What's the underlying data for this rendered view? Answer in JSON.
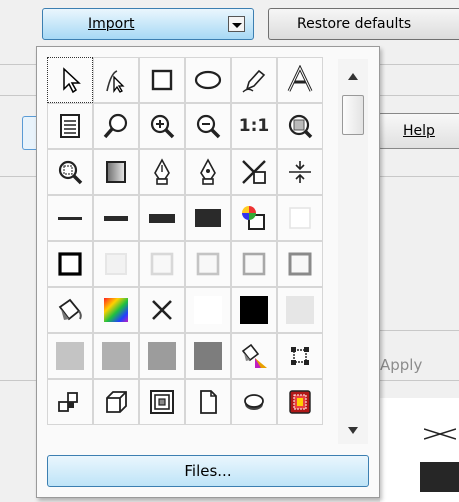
{
  "toolbar": {
    "import_label": "Import",
    "restore_label": "Restore defaults"
  },
  "background": {
    "help_label": "Help",
    "apply_label": "Apply"
  },
  "popup": {
    "files_label": "Files...",
    "zoom_one_to_one_label": "1:1",
    "icons": [
      [
        "select-arrow-icon",
        "node-edit-icon",
        "rectangle-tool-icon",
        "ellipse-tool-icon",
        "pencil-tool-icon",
        "text-tool-icon"
      ],
      [
        "document-icon",
        "zoom-icon",
        "zoom-in-icon",
        "zoom-out-icon",
        "zoom-one-to-one-icon",
        "zoom-fit-icon"
      ],
      [
        "zoom-selection-icon",
        "gradient-box-icon",
        "pen-nib-icon",
        "pen-outline-icon",
        "cross-box-icon",
        "snap-icon"
      ],
      [
        "thin-line-icon",
        "medium-line-icon",
        "thick-bar-icon",
        "thicker-bar-icon",
        "color-wheel-icon",
        "blank-square-icon"
      ],
      [
        "black-outline-square-icon",
        "faint-square-icon",
        "light-outline-square-icon",
        "gray-outline-square-icon",
        "mid-outline-square-icon",
        "dark-outline-square-icon"
      ],
      [
        "fill-bucket-icon",
        "color-palette-icon",
        "no-fill-x-icon",
        "white-fill-icon",
        "black-fill-icon",
        "light-gray-fill-icon"
      ],
      [
        "gray-fill-20-icon",
        "gray-fill-40-icon",
        "gray-fill-60-icon",
        "gray-fill-80-icon",
        "fill-color-icon",
        "node-handles-icon"
      ],
      [
        "shapes-icon",
        "3d-box-icon",
        "concentric-squares-icon",
        "page-icon",
        "button-shape-icon",
        "red-stamp-icon"
      ]
    ]
  }
}
